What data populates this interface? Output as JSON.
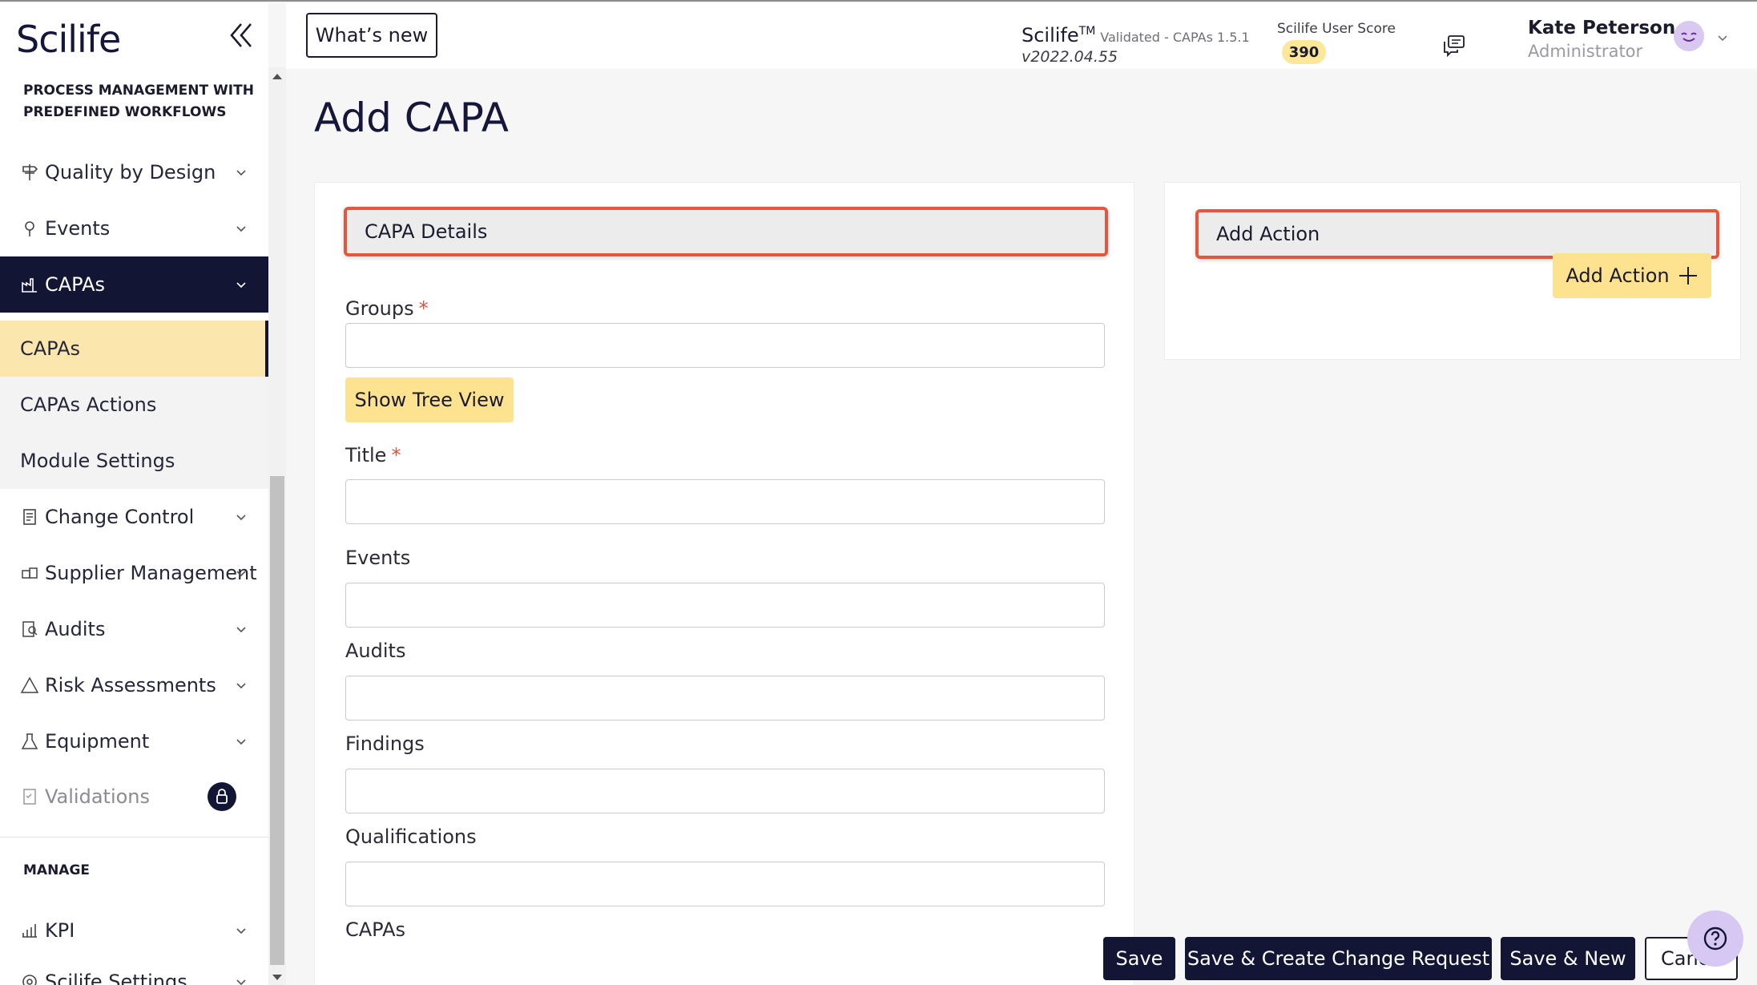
{
  "sidebar": {
    "logo": "Scilife",
    "section_process": "PROCESS MANAGEMENT WITH PREDEFINED WORKFLOWS",
    "items": [
      {
        "label": "Quality by Design",
        "icon": "signpost-icon"
      },
      {
        "label": "Events",
        "icon": "pin-icon"
      },
      {
        "label": "CAPAs",
        "icon": "factory-icon"
      },
      {
        "label": "CAPAs"
      },
      {
        "label": "CAPAs Actions"
      },
      {
        "label": "Module Settings"
      },
      {
        "label": "Change Control",
        "icon": "clipboard-icon"
      },
      {
        "label": "Supplier Management",
        "icon": "boxes-icon"
      },
      {
        "label": "Audits",
        "icon": "audit-icon"
      },
      {
        "label": "Risk Assessments",
        "icon": "warning-icon"
      },
      {
        "label": "Equipment",
        "icon": "flask-icon"
      },
      {
        "label": "Validations",
        "icon": "checklist-icon"
      }
    ],
    "section_manage": "MANAGE",
    "manage_items": [
      {
        "label": "KPI",
        "icon": "chart-icon"
      },
      {
        "label": "Scilife Settings",
        "icon": "settings-icon"
      }
    ]
  },
  "header": {
    "whats_new": "What’s new",
    "app_name": "Scilife",
    "trademark": "TM",
    "validated": "Validated - CAPAs 1.5.1",
    "version": "v2022.04.55",
    "score_label": "Scilife User Score",
    "score": "390",
    "user_name": "Kate Peterson",
    "user_role": "Administrator"
  },
  "page": {
    "title": "Add CAPA",
    "capa_details": "CAPA Details",
    "add_action_heading": "Add Action",
    "add_action_button": "Add Action",
    "show_tree_view": "Show Tree View",
    "fields": {
      "groups": "Groups",
      "title": "Title",
      "events": "Events",
      "audits": "Audits",
      "findings": "Findings",
      "qualifications": "Qualifications",
      "next_partial": "CAPAs"
    },
    "required_mark": "*"
  },
  "footer": {
    "save": "Save",
    "save_create_cr": "Save & Create Change Request",
    "save_new": "Save & New",
    "cancel": "Cancel"
  },
  "colors": {
    "navy": "#121634",
    "accent_yellow": "#fde28f",
    "highlight_red": "#e8553d",
    "help_purple": "#d6c7f3"
  }
}
